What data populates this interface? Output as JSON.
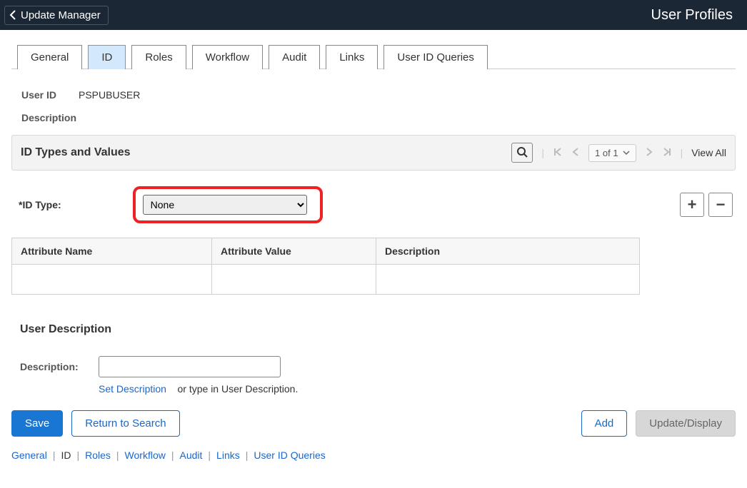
{
  "header": {
    "back_label": "Update Manager",
    "page_title": "User Profiles"
  },
  "tabs": [
    {
      "label": "General"
    },
    {
      "label": "ID"
    },
    {
      "label": "Roles"
    },
    {
      "label": "Workflow"
    },
    {
      "label": "Audit"
    },
    {
      "label": "Links"
    },
    {
      "label": "User ID Queries"
    }
  ],
  "user": {
    "id_label": "User ID",
    "id_value": "PSPUBUSER",
    "description_label": "Description"
  },
  "section": {
    "title": "ID Types and Values",
    "pager": "1 of 1",
    "view_all": "View All"
  },
  "id_type": {
    "label": "*ID Type:",
    "selected": "None"
  },
  "table": {
    "cols": [
      "Attribute Name",
      "Attribute Value",
      "Description"
    ]
  },
  "user_desc": {
    "title": "User Description",
    "label": "Description:",
    "link": "Set Description",
    "hint": "or type in User Description."
  },
  "buttons": {
    "save": "Save",
    "return": "Return to Search",
    "add": "Add",
    "update": "Update/Display"
  },
  "bottom_links": [
    "General",
    "ID",
    "Roles",
    "Workflow",
    "Audit",
    "Links",
    "User ID Queries"
  ]
}
